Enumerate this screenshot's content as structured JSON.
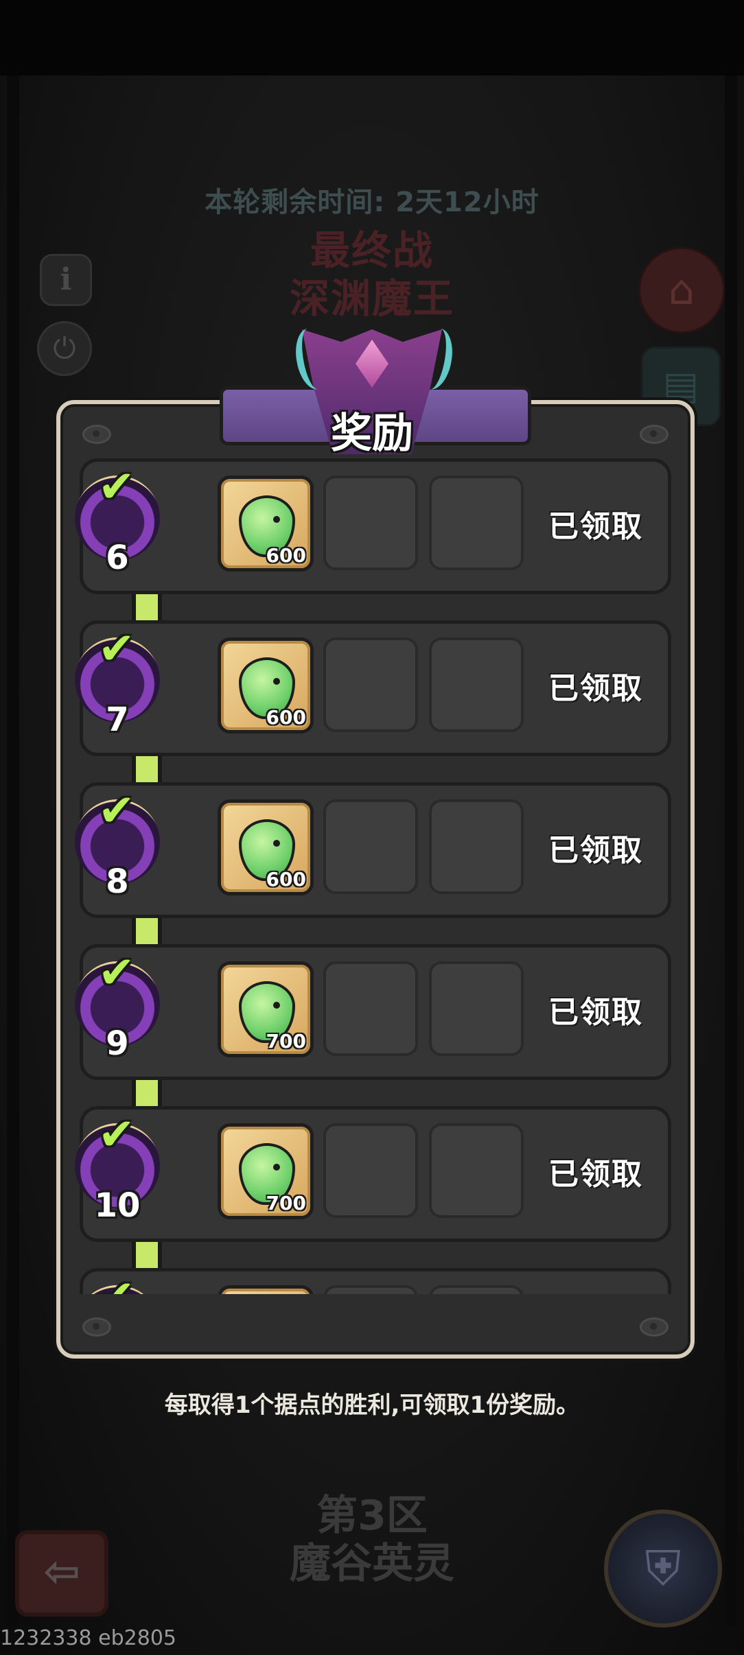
{
  "header": {
    "timer_text": "本轮剩余时间: 2天12小时",
    "boss_line1": "最终战",
    "boss_line2": "深渊魔王"
  },
  "panel": {
    "title": "奖励",
    "rows": [
      {
        "stage": "6",
        "reward_qty": "600",
        "status": "已领取"
      },
      {
        "stage": "7",
        "reward_qty": "600",
        "status": "已领取"
      },
      {
        "stage": "8",
        "reward_qty": "600",
        "status": "已领取"
      },
      {
        "stage": "9",
        "reward_qty": "700",
        "status": "已领取"
      },
      {
        "stage": "10",
        "reward_qty": "700",
        "status": "已领取"
      },
      {
        "stage": "",
        "reward_qty": "",
        "status": ""
      }
    ]
  },
  "hint": "每取得1个据点的胜利,可领取1份奖励。",
  "zone": {
    "line1": "第3区",
    "line2": "魔谷英灵"
  },
  "icons": {
    "info": "info-icon",
    "power": "power-icon",
    "shop": "shop-icon",
    "quest": "quest-board-icon",
    "back": "back-arrow-icon",
    "hero": "hero-helmet-icon",
    "check": "check-icon",
    "slime": "green-slime-icon"
  },
  "build_id": "1232338 eb2805",
  "colors": {
    "accent_green": "#c8e86a",
    "banner_purple": "#6a509a",
    "panel_border": "#d8cdb8"
  }
}
